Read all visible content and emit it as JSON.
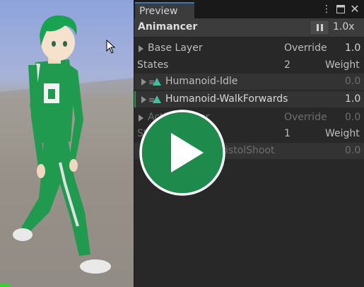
{
  "tab": {
    "label": "Preview"
  },
  "header": {
    "title": "Animancer",
    "speed": "1.0x"
  },
  "layers": [
    {
      "name": "Base Layer",
      "mode": "Override",
      "weight": "1.0",
      "states_label": "States",
      "state_count": "2",
      "weight_label": "Weight",
      "states": [
        {
          "name": "Humanoid-Idle",
          "weight": "0.0"
        },
        {
          "name": "Humanoid-WalkForwards",
          "weight": "1.0"
        }
      ]
    },
    {
      "name": "Action Layer",
      "mode": "Override",
      "weight": "0.0",
      "states_label": "States",
      "state_count": "1",
      "weight_label": "Weight",
      "states": [
        {
          "name": "Humanoid-PistolShoot",
          "weight": "0.0"
        }
      ]
    }
  ],
  "colors": {
    "accent": "#3a79bb",
    "play_green": "#1e8a4c",
    "character_green": "#1f9a4f",
    "state_icon": "#3fbfa0"
  },
  "icons": {
    "menu": "kebab-menu-icon",
    "maximize": "maximize-icon",
    "close": "close-icon",
    "pause": "pause-icon",
    "play": "play-icon"
  }
}
